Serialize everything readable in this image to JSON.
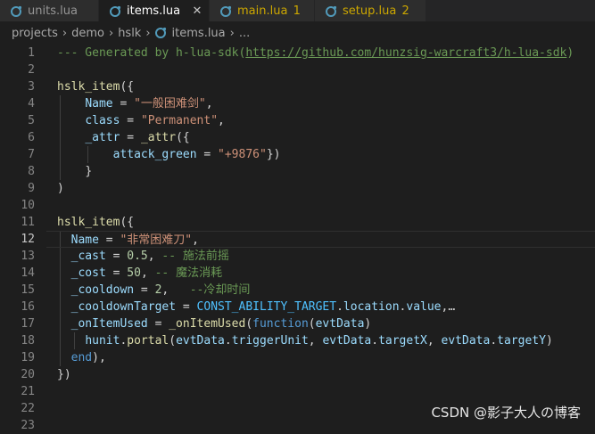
{
  "tabs": [
    {
      "label": "units.lua",
      "icon": "lua-icon",
      "active": false,
      "badge": ""
    },
    {
      "label": "items.lua",
      "icon": "lua-icon",
      "active": true,
      "badge": ""
    },
    {
      "label": "main.lua",
      "icon": "lua-icon",
      "active": false,
      "badge": "1"
    },
    {
      "label": "setup.lua",
      "icon": "lua-icon",
      "active": false,
      "badge": "2"
    }
  ],
  "close_glyph": "✕",
  "breadcrumb": {
    "items": [
      "projects",
      "demo",
      "hslk",
      "items.lua",
      "..."
    ],
    "separator": "›"
  },
  "editor": {
    "line_numbers": [
      "1",
      "2",
      "3",
      "4",
      "5",
      "6",
      "7",
      "8",
      "9",
      "10",
      "11",
      "12",
      "13",
      "14",
      "15",
      "16",
      "17",
      "18",
      "19",
      "20",
      "21",
      "22",
      "23"
    ],
    "current_line": "12",
    "code": {
      "l1_comment": "--- Generated by h-lua-sdk(",
      "l1_link": "https://github.com/hunzsig-warcraft3/h-lua-sdk",
      "l1_end": ")",
      "l3_fn": "hslk_item",
      "l3_punc": "({",
      "l4_key": "Name",
      "l4_eq": " = ",
      "l4_val": "\"一般困难剑\"",
      "l4_comma": ",",
      "l5_key": "class",
      "l5_eq": " = ",
      "l5_val": "\"Permanent\"",
      "l5_comma": ",",
      "l6_key": "_attr",
      "l6_eq": " = ",
      "l6_fn": "_attr",
      "l6_punc": "({",
      "l7_key": "attack_green",
      "l7_eq": " = ",
      "l7_val": "\"+9876\"",
      "l7_punc": "})",
      "l8_punc": "}",
      "l9_punc": ")",
      "l11_fn": "hslk_item",
      "l11_punc": "({",
      "l12_key": "Name",
      "l12_eq": " = ",
      "l12_val": "\"非常困难刀\"",
      "l12_comma": ",",
      "l13_key": "_cast",
      "l13_eq": " = ",
      "l13_num": "0.5",
      "l13_comma": ", ",
      "l13_com": "-- 施法前摇",
      "l14_key": "_cost",
      "l14_eq": " = ",
      "l14_num": "50",
      "l14_comma": ", ",
      "l14_com": "-- 魔法消耗",
      "l15_key": "_cooldown",
      "l15_eq": " = ",
      "l15_num": "2",
      "l15_comma": ",   ",
      "l15_com": "--冷却时间",
      "l16_key": "_cooldownTarget",
      "l16_eq": " = ",
      "l16_const": "CONST_ABILITY_TARGET",
      "l16_dot1": ".",
      "l16_p1": "location",
      "l16_dot2": ".",
      "l16_p2": "value",
      "l16_end": ",…",
      "l17_key": "_onItemUsed",
      "l17_eq": " = ",
      "l17_fn": "_onItemUsed",
      "l17_paren": "(",
      "l17_kw": "function",
      "l17_paren2": "(",
      "l17_arg": "evtData",
      "l17_paren3": ")",
      "l18_obj": "hunit",
      "l18_dot": ".",
      "l18_fn": "portal",
      "l18_paren": "(",
      "l18_a1": "evtData",
      "l18_d1": ".",
      "l18_p1": "triggerUnit",
      "l18_c1": ", ",
      "l18_a2": "evtData",
      "l18_d2": ".",
      "l18_p2": "targetX",
      "l18_c2": ", ",
      "l18_a3": "evtData",
      "l18_d3": ".",
      "l18_p3": "targetY",
      "l18_end": ")",
      "l19_kw": "end",
      "l19_punc": "),",
      "l20_punc": "})"
    }
  },
  "watermark": "CSDN @影子大人の博客",
  "colors": {
    "editor_bg": "#1e1e1e",
    "comment": "#6a9955",
    "string": "#ce9178",
    "variable": "#9cdcfe",
    "function": "#dcdcaa",
    "keyword": "#569cd6",
    "constant": "#4fc1ff",
    "number": "#b5cea8",
    "warning": "#cca700"
  }
}
